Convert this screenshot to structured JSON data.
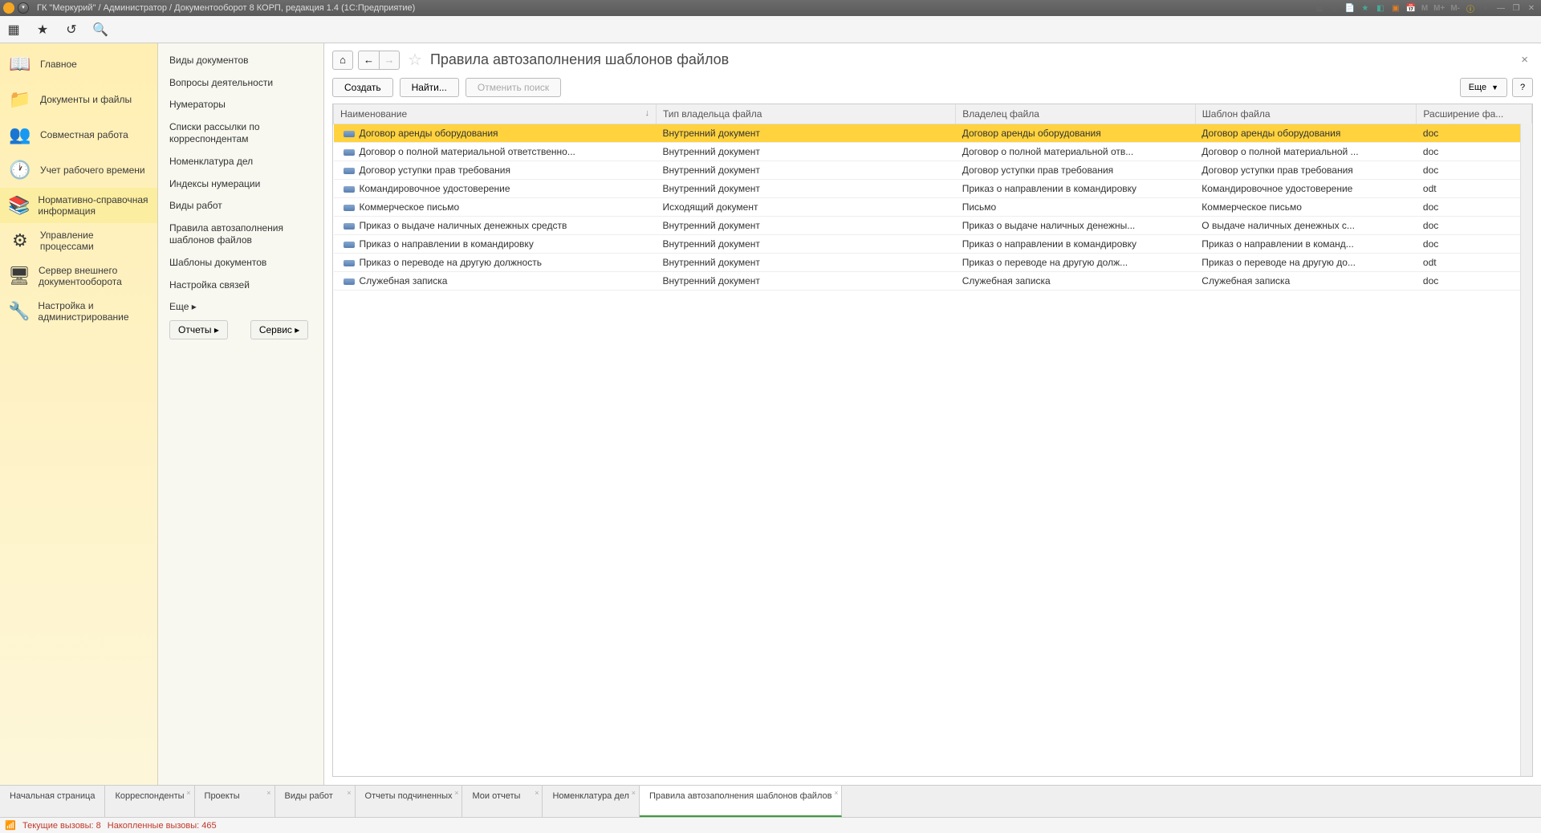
{
  "titlebar": {
    "text": "ГК \"Меркурий\" / Администратор / Документооборот 8 КОРП, редакция 1.4  (1С:Предприятие)",
    "m1": "M",
    "m2": "M+",
    "m3": "M-"
  },
  "sidebar": {
    "items": [
      {
        "label": "Главное",
        "icon": "📖"
      },
      {
        "label": "Документы и файлы",
        "icon": "📁"
      },
      {
        "label": "Совместная работа",
        "icon": "👥"
      },
      {
        "label": "Учет рабочего времени",
        "icon": "🕐"
      },
      {
        "label": "Нормативно-справочная информация",
        "icon": "📚"
      },
      {
        "label": "Управление процессами",
        "icon": "⚙"
      },
      {
        "label": "Сервер внешнего документооборота",
        "icon": "🖥"
      },
      {
        "label": "Настройка и администрирование",
        "icon": "🔧"
      }
    ]
  },
  "subsidebar": {
    "items": [
      "Виды документов",
      "Вопросы деятельности",
      "Нумераторы",
      "Списки рассылки по корреспондентам",
      "Номенклатура дел",
      "Индексы нумерации",
      "Виды работ",
      "Правила автозаполнения шаблонов файлов",
      "Шаблоны документов",
      "Настройка связей"
    ],
    "more": "Еще ▸",
    "reports": "Отчеты ▸",
    "service": "Сервис ▸"
  },
  "page": {
    "title": "Правила автозаполнения шаблонов файлов",
    "create": "Создать",
    "find": "Найти...",
    "cancel": "Отменить поиск",
    "more": "Еще",
    "help": "?"
  },
  "table": {
    "cols": [
      "Наименование",
      "Тип владельца файла",
      "Владелец файла",
      "Шаблон файла",
      "Расширение фа..."
    ],
    "sort": "↓",
    "rows": [
      {
        "c": [
          "Договор аренды оборудования",
          "Внутренний документ",
          "Договор аренды оборудования",
          "Договор аренды оборудования",
          "doc"
        ],
        "sel": true
      },
      {
        "c": [
          "Договор о полной материальной ответственно...",
          "Внутренний документ",
          "Договор о полной материальной отв...",
          "Договор о полной материальной ...",
          "doc"
        ]
      },
      {
        "c": [
          "Договор уступки прав требования",
          "Внутренний документ",
          "Договор уступки прав требования",
          "Договор уступки прав требования",
          "doc"
        ]
      },
      {
        "c": [
          "Командировочное удостоверение",
          "Внутренний документ",
          "Приказ о направлении в командировку",
          "Командировочное удостоверение",
          "odt"
        ]
      },
      {
        "c": [
          "Коммерческое письмо",
          "Исходящий документ",
          "Письмо",
          "Коммерческое письмо",
          "doc"
        ]
      },
      {
        "c": [
          "Приказ о выдаче наличных денежных средств",
          "Внутренний документ",
          "Приказ о выдаче наличных денежны...",
          "О выдаче наличных денежных с...",
          "doc"
        ]
      },
      {
        "c": [
          "Приказ о направлении в командировку",
          "Внутренний документ",
          "Приказ о направлении в командировку",
          "Приказ о направлении в команд...",
          "doc"
        ]
      },
      {
        "c": [
          "Приказ о переводе на другую должность",
          "Внутренний документ",
          "Приказ о переводе на другую долж...",
          "Приказ о переводе на другую до...",
          "odt"
        ]
      },
      {
        "c": [
          "Служебная записка",
          "Внутренний документ",
          "Служебная записка",
          "Служебная записка",
          "doc"
        ]
      }
    ]
  },
  "tabs": [
    {
      "label": "Начальная страница",
      "closable": false
    },
    {
      "label": "Корреспонденты",
      "closable": true
    },
    {
      "label": "Проекты",
      "closable": true
    },
    {
      "label": "Виды работ",
      "closable": true
    },
    {
      "label": "Отчеты подчиненных",
      "closable": true
    },
    {
      "label": "Мои отчеты",
      "closable": true
    },
    {
      "label": "Номенклатура дел",
      "closable": true
    },
    {
      "label": "Правила автозаполнения шаблонов файлов",
      "closable": true,
      "active": true
    }
  ],
  "status": {
    "calls": "Текущие вызовы: 8",
    "accum": "Накопленные вызовы: 465"
  }
}
